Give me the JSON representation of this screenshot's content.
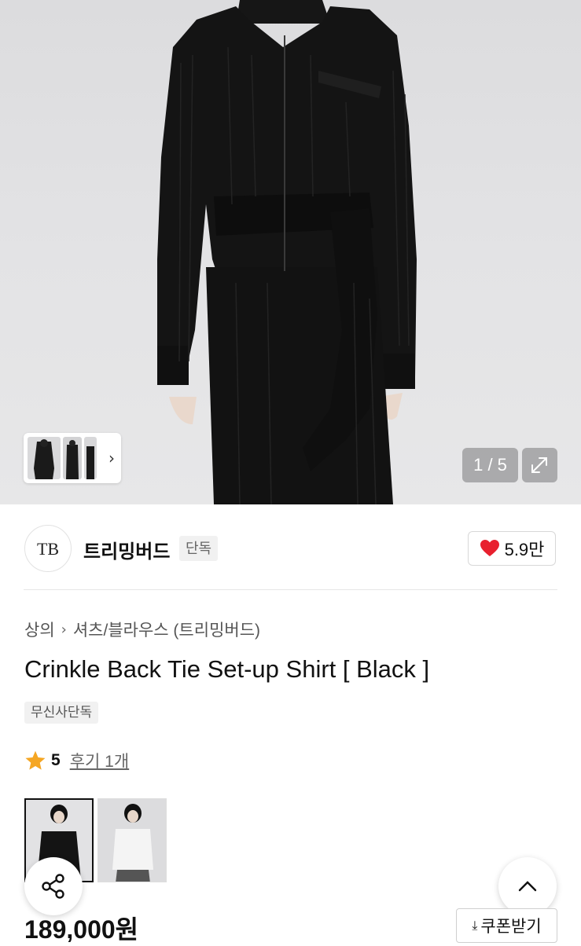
{
  "gallery": {
    "counter": "1 / 5",
    "thumbnail_next_icon": "chevron-right-icon",
    "expand_icon": "expand-icon",
    "colors": {
      "background": "#e2e2e4",
      "garment": "#141414"
    }
  },
  "brand": {
    "logo_text": "TB",
    "name": "트리밍버드",
    "badge": "단독",
    "like_count": "5.9만",
    "like_icon": "heart-icon",
    "like_color": "#e8202e"
  },
  "breadcrumb": {
    "items": [
      "상의",
      "셔츠/블라우스 (트리밍버드)"
    ],
    "separator_icon": "chevron-right-icon"
  },
  "product": {
    "title": "Crinkle Back Tie Set-up Shirt [ Black ]",
    "badge": "무신사단독",
    "rating_score": "5",
    "rating_icon": "star-icon",
    "star_color": "#f5a623",
    "reviews": "후기 1개",
    "price": "189,000원"
  },
  "variants": [
    {
      "name": "black",
      "selected": true
    },
    {
      "name": "white",
      "selected": false
    }
  ],
  "actions": {
    "share_icon": "share-icon",
    "scroll_top_icon": "chevron-up-icon",
    "coupon_label": "쿠폰받기",
    "coupon_icon": "download-icon"
  }
}
